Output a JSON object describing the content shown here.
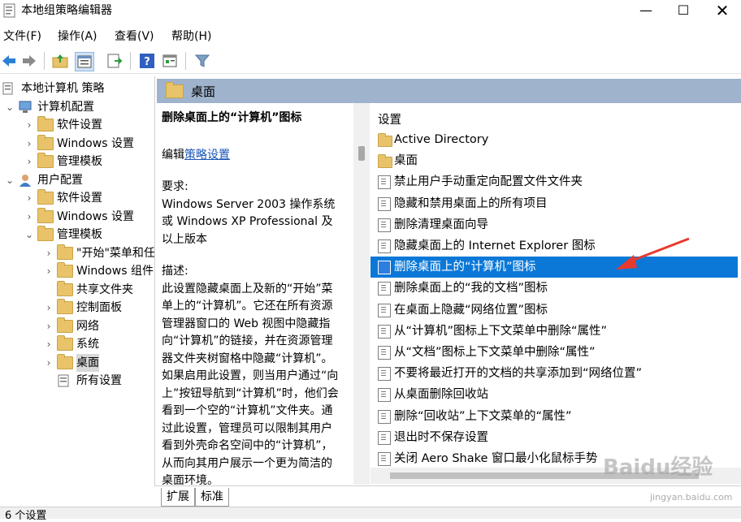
{
  "window": {
    "title": "本地组策略编辑器"
  },
  "menu": [
    "文件(F)",
    "操作(A)",
    "查看(V)",
    "帮助(H)"
  ],
  "tree": [
    {
      "label": "本地计算机 策略",
      "level": 0,
      "expand": "",
      "icon": "policy-icon"
    },
    {
      "label": "计算机配置",
      "level": 1,
      "expand": "v",
      "icon": "computer-icon"
    },
    {
      "label": "软件设置",
      "level": 2,
      "expand": ">",
      "icon": "folder-icon"
    },
    {
      "label": "Windows 设置",
      "level": 2,
      "expand": ">",
      "icon": "folder-icon"
    },
    {
      "label": "管理模板",
      "level": 2,
      "expand": ">",
      "icon": "folder-icon"
    },
    {
      "label": "用户配置",
      "level": 1,
      "expand": "v",
      "icon": "user-icon"
    },
    {
      "label": "软件设置",
      "level": 2,
      "expand": ">",
      "icon": "folder-icon"
    },
    {
      "label": "Windows 设置",
      "level": 2,
      "expand": ">",
      "icon": "folder-icon"
    },
    {
      "label": "管理模板",
      "level": 2,
      "expand": "v",
      "icon": "folder-icon"
    },
    {
      "label": "\"开始\"菜单和任",
      "level": 3,
      "expand": ">",
      "icon": "folder-icon"
    },
    {
      "label": "Windows 组件",
      "level": 3,
      "expand": ">",
      "icon": "folder-icon"
    },
    {
      "label": "共享文件夹",
      "level": 3,
      "expand": "",
      "icon": "folder-icon"
    },
    {
      "label": "控制面板",
      "level": 3,
      "expand": ">",
      "icon": "folder-icon"
    },
    {
      "label": "网络",
      "level": 3,
      "expand": ">",
      "icon": "folder-icon"
    },
    {
      "label": "系统",
      "level": 3,
      "expand": ">",
      "icon": "folder-icon"
    },
    {
      "label": "桌面",
      "level": 3,
      "expand": ">",
      "icon": "folder-icon",
      "selected": true
    },
    {
      "label": "所有设置",
      "level": 3,
      "expand": "",
      "icon": "all-settings-icon"
    }
  ],
  "header": {
    "title": "桌面"
  },
  "description": {
    "heading": "删除桌面上的“计算机”图标",
    "edit_prefix": "编辑",
    "edit_link": "策略设置",
    "req_label": "要求:",
    "req_text": "Windows Server 2003 操作系统或 Windows XP Professional 及以上版本",
    "desc_label": "描述:",
    "desc_text": "此设置隐藏桌面上及新的“开始”菜单上的“计算机”。它还在所有资源管理器窗口的 Web 视图中隐藏指向“计算机”的链接，并在资源管理器文件夹树窗格中隐藏“计算机”。如果启用此设置，则当用户通过“向上”按钮导航到“计算机”时，他们会看到一个空的“计算机”文件夹。通过此设置，管理员可以限制其用户看到外壳命名空间中的“计算机”，从而向其用户展示一个更为简洁的桌面环境。"
  },
  "list": {
    "column_header": "设置",
    "items": [
      {
        "label": "Active Directory",
        "icon": "folder-icon"
      },
      {
        "label": "桌面",
        "icon": "folder-icon"
      },
      {
        "label": "禁止用户手动重定向配置文件文件夹",
        "icon": "setting-icon"
      },
      {
        "label": "隐藏和禁用桌面上的所有项目",
        "icon": "setting-icon"
      },
      {
        "label": "删除清理桌面向导",
        "icon": "setting-icon"
      },
      {
        "label": "隐藏桌面上的 Internet Explorer 图标",
        "icon": "setting-icon"
      },
      {
        "label": "删除桌面上的“计算机”图标",
        "icon": "setting-icon",
        "selected": true
      },
      {
        "label": "删除桌面上的“我的文档”图标",
        "icon": "setting-icon"
      },
      {
        "label": "在桌面上隐藏“网络位置”图标",
        "icon": "setting-icon"
      },
      {
        "label": "从“计算机”图标上下文菜单中删除“属性”",
        "icon": "setting-icon"
      },
      {
        "label": "从“文档”图标上下文菜单中删除“属性”",
        "icon": "setting-icon"
      },
      {
        "label": "不要将最近打开的文档的共享添加到“网络位置”",
        "icon": "setting-icon"
      },
      {
        "label": "从桌面删除回收站",
        "icon": "setting-icon"
      },
      {
        "label": "删除“回收站”上下文菜单的“属性”",
        "icon": "setting-icon"
      },
      {
        "label": "退出时不保存设置",
        "icon": "setting-icon"
      },
      {
        "label": "关闭 Aero Shake 窗口最小化鼠标手势",
        "icon": "setting-icon"
      }
    ]
  },
  "tabs": [
    "扩展",
    "标准"
  ],
  "status": {
    "text": "6 个设置"
  },
  "watermark": {
    "logo": "Baidu经验",
    "url": "jingyan.baidu.com"
  },
  "colors": {
    "selection": "#0b78d7",
    "header": "#9fb4cc",
    "arrow": "#e8392f"
  }
}
